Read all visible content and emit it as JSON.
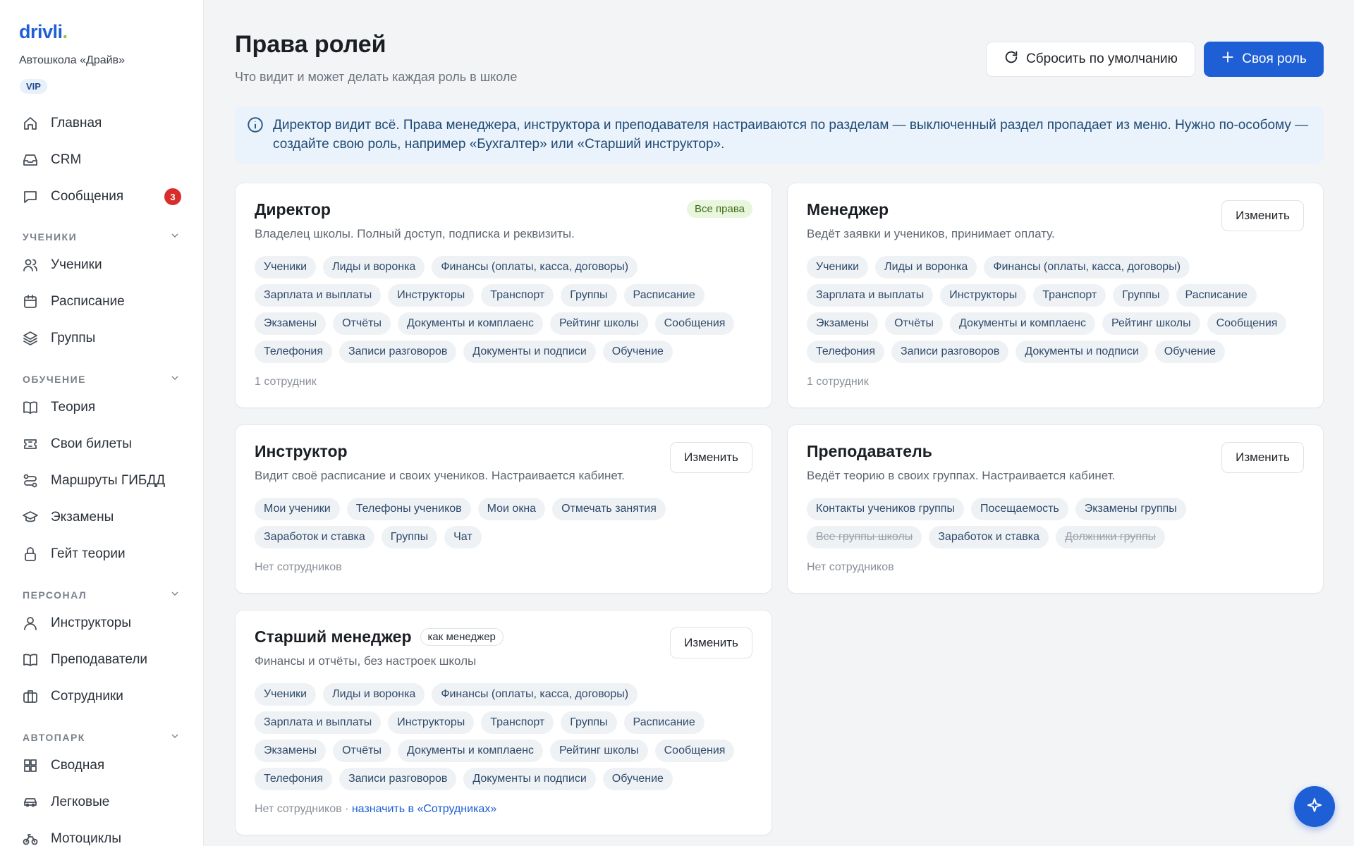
{
  "sidebar": {
    "logo": "drivli",
    "logo_dot": ".",
    "school": "Автошкола «Драйв»",
    "vip": "VIP",
    "items_top": [
      {
        "label": "Главная",
        "icon": "home-icon"
      },
      {
        "label": "CRM",
        "icon": "inbox-icon"
      },
      {
        "label": "Сообщения",
        "icon": "message-icon",
        "badge": "3"
      }
    ],
    "sections": [
      {
        "title": "УЧЕНИКИ",
        "items": [
          {
            "label": "Ученики",
            "icon": "users-icon"
          },
          {
            "label": "Расписание",
            "icon": "calendar-icon"
          },
          {
            "label": "Группы",
            "icon": "layers-icon"
          }
        ]
      },
      {
        "title": "ОБУЧЕНИЕ",
        "items": [
          {
            "label": "Теория",
            "icon": "book-icon"
          },
          {
            "label": "Свои билеты",
            "icon": "ticket-icon"
          },
          {
            "label": "Маршруты ГИБДД",
            "icon": "route-icon"
          },
          {
            "label": "Экзамены",
            "icon": "graduation-icon"
          },
          {
            "label": "Гейт теории",
            "icon": "lock-icon"
          }
        ]
      },
      {
        "title": "ПЕРСОНАЛ",
        "items": [
          {
            "label": "Инструкторы",
            "icon": "user-icon"
          },
          {
            "label": "Преподаватели",
            "icon": "book-open-icon"
          },
          {
            "label": "Сотрудники",
            "icon": "briefcase-icon"
          }
        ]
      },
      {
        "title": "АВТОПАРК",
        "items": [
          {
            "label": "Сводная",
            "icon": "grid-icon"
          },
          {
            "label": "Легковые",
            "icon": "car-icon"
          },
          {
            "label": "Мотоциклы",
            "icon": "bike-icon"
          }
        ]
      }
    ]
  },
  "header": {
    "title": "Права ролей",
    "subtitle": "Что видит и может делать каждая роль в школе",
    "reset_label": "Сбросить по умолчанию",
    "add_role_label": "Своя роль"
  },
  "info": {
    "text": "Директор видит всё. Права менеджера, инструктора и преподавателя настраиваются по разделам — выключенный раздел пропадает из меню. Нужно по-особому — создайте свою роль, например «Бухгалтер» или «Старший инструктор»."
  },
  "roles": {
    "director": {
      "title": "Директор",
      "badge": "Все права",
      "desc": "Владелец школы. Полный доступ, подписка и реквизиты.",
      "chips": [
        "Ученики",
        "Лиды и воронка",
        "Финансы (оплаты, касса, договоры)",
        "Зарплата и выплаты",
        "Инструкторы",
        "Транспорт",
        "Группы",
        "Расписание",
        "Экзамены",
        "Отчёты",
        "Документы и комплаенс",
        "Рейтинг школы",
        "Сообщения",
        "Телефония",
        "Записи разговоров",
        "Документы и подписи",
        "Обучение"
      ],
      "footer": "1 сотрудник"
    },
    "manager": {
      "title": "Менеджер",
      "edit": "Изменить",
      "desc": "Ведёт заявки и учеников, принимает оплату.",
      "chips": [
        "Ученики",
        "Лиды и воронка",
        "Финансы (оплаты, касса, договоры)",
        "Зарплата и выплаты",
        "Инструкторы",
        "Транспорт",
        "Группы",
        "Расписание",
        "Экзамены",
        "Отчёты",
        "Документы и комплаенс",
        "Рейтинг школы",
        "Сообщения",
        "Телефония",
        "Записи разговоров",
        "Документы и подписи",
        "Обучение"
      ],
      "footer": "1 сотрудник"
    },
    "instructor": {
      "title": "Инструктор",
      "edit": "Изменить",
      "desc": "Видит своё расписание и своих учеников. Настраивается кабинет.",
      "chips": [
        "Мои ученики",
        "Телефоны учеников",
        "Мои окна",
        "Отмечать занятия",
        "Заработок и ставка",
        "Группы",
        "Чат"
      ],
      "footer": "Нет сотрудников"
    },
    "teacher": {
      "title": "Преподаватель",
      "edit": "Изменить",
      "desc": "Ведёт теорию в своих группах. Настраивается кабинет.",
      "chips": [
        {
          "label": "Контакты учеников группы",
          "off": false
        },
        {
          "label": "Посещаемость",
          "off": false
        },
        {
          "label": "Экзамены группы",
          "off": false
        },
        {
          "label": "Все группы школы",
          "off": true
        },
        {
          "label": "Заработок и ставка",
          "off": false
        },
        {
          "label": "Должники группы",
          "off": true
        }
      ],
      "footer": "Нет сотрудников"
    },
    "senior": {
      "title": "Старший менеджер",
      "tag": "как менеджер",
      "edit": "Изменить",
      "desc": "Финансы и отчёты, без настроек школы",
      "chips": [
        "Ученики",
        "Лиды и воронка",
        "Финансы (оплаты, касса, договоры)",
        "Зарплата и выплаты",
        "Инструкторы",
        "Транспорт",
        "Группы",
        "Расписание",
        "Экзамены",
        "Отчёты",
        "Документы и комплаенс",
        "Рейтинг школы",
        "Сообщения",
        "Телефония",
        "Записи разговоров",
        "Документы и подписи",
        "Обучение"
      ],
      "footer": "Нет сотрудников · ",
      "footer_link": "назначить в «Сотрудниках»"
    }
  }
}
